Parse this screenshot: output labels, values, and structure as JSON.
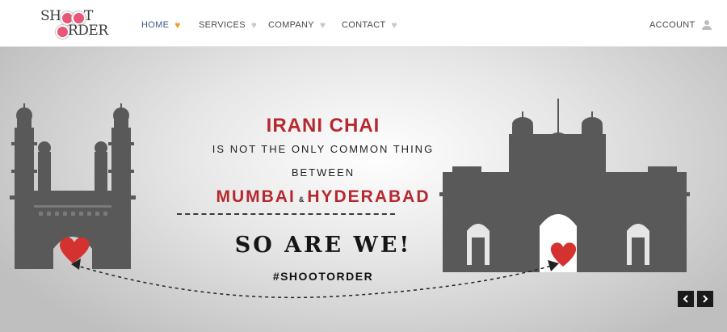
{
  "header": {
    "logo": {
      "line1": "SH",
      "line1_tail": "T",
      "line2": "RDER"
    },
    "menu": [
      {
        "label": "HOME",
        "active": true
      },
      {
        "label": "SERVICES",
        "active": false
      },
      {
        "label": "COMPANY",
        "active": false
      },
      {
        "label": "CONTACT",
        "active": false
      }
    ],
    "account_label": "ACCOUNT"
  },
  "hero": {
    "headline": "IRANI CHAI",
    "line2": "IS NOT THE ONLY COMMON THING",
    "line3": "BETWEEN",
    "city1": "MUMBAI",
    "ampersand": "&",
    "city2": "HYDERABAD",
    "tagline": "SO ARE WE!",
    "hashtag": "#SHOOTORDER"
  },
  "colors": {
    "accent_red": "#b7282e",
    "heart_active": "#f39a2c",
    "heart_inactive": "#c8c8c8",
    "monument": "#595959",
    "slider_button": "#1a1a1a"
  },
  "icons": {
    "nav_heart": "heart-icon",
    "account": "user-icon",
    "prev": "chevron-left-icon",
    "next": "chevron-right-icon"
  }
}
